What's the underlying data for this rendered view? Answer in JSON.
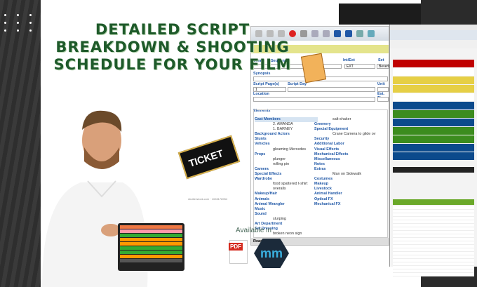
{
  "headline": {
    "line1": "DETAILED SCRIPT",
    "line2": "BREAKDOWN & SHOOTING",
    "line3": "SCHEDULE FOR YOUR FILM"
  },
  "app": {
    "labels": {
      "scene": "Scene",
      "sequence": "Sequence",
      "int_ext": "Int/Ext",
      "set": "Set",
      "synopsis": "Synopsis",
      "script_pages": "Script Page(s)",
      "script_day": "Script Day",
      "unit": "Unit",
      "location": "Location",
      "est_time": "Est. Tim",
      "elements": "Elements"
    },
    "values": {
      "int_ext": "EXT",
      "set": "Beverly",
      "script_pages": "1"
    },
    "col1": [
      {
        "cat": "Cast Members"
      },
      {
        "item": "2. AMANDA"
      },
      {
        "item": "1. BARNEY"
      },
      {
        "cat": "Background Actors"
      },
      {
        "cat": "Stunts"
      },
      {
        "cat": "Vehicles"
      },
      {
        "item": "gleaming Mercedes"
      },
      {
        "cat": "Props"
      },
      {
        "item": "plunger"
      },
      {
        "item": "rolling pin"
      },
      {
        "cat": "Camera"
      },
      {
        "cat": "Special Effects"
      },
      {
        "cat": "Wardrobe"
      },
      {
        "item": "food spattered t-shirt"
      },
      {
        "item": "overalls"
      },
      {
        "cat": "Makeup/Hair"
      },
      {
        "cat": "Animals"
      },
      {
        "cat": "Animal Wrangler"
      },
      {
        "cat": "Music"
      },
      {
        "cat": "Sound"
      },
      {
        "item": "slurping"
      },
      {
        "cat": "Art Department"
      },
      {
        "cat": "Set Dressing"
      },
      {
        "item": "broken neon sign"
      }
    ],
    "col2": [
      {
        "item": "salt-shaker"
      },
      {
        "cat": "Greenery"
      },
      {
        "cat": "Special Equipment"
      },
      {
        "item": "Crane Camera to glide ov"
      },
      {
        "cat": "Security"
      },
      {
        "cat": "Additional Labor"
      },
      {
        "cat": "Visual Effects"
      },
      {
        "cat": "Mechanical Effects"
      },
      {
        "cat": "Miscellaneous"
      },
      {
        "cat": "Notes"
      },
      {
        "cat": "Extras"
      },
      {
        "item": "Man on Sidewalk"
      },
      {
        "cat": "Costumes"
      },
      {
        "cat": "Makeup"
      },
      {
        "cat": "Livestock"
      },
      {
        "cat": "Animal Handler"
      },
      {
        "cat": "Optical FX"
      },
      {
        "cat": "Mechanical FX"
      }
    ],
    "status": "Ready"
  },
  "schedule_rows": [
    "#c00000",
    "#ffffff",
    "#e6cf45",
    "#e6cf45",
    "#ffffff",
    "#0b4a8c",
    "#3c8c1e",
    "#0b4a8c",
    "#3c8c1e",
    "#3c8c1e",
    "#0b4a8c",
    "#0b4a8c"
  ],
  "ticket": {
    "text": "TICKET"
  },
  "credit": "shutterstock.com · 1028178954",
  "available": "Available in",
  "pdf_label": "PDF",
  "mm_logo": "mm"
}
